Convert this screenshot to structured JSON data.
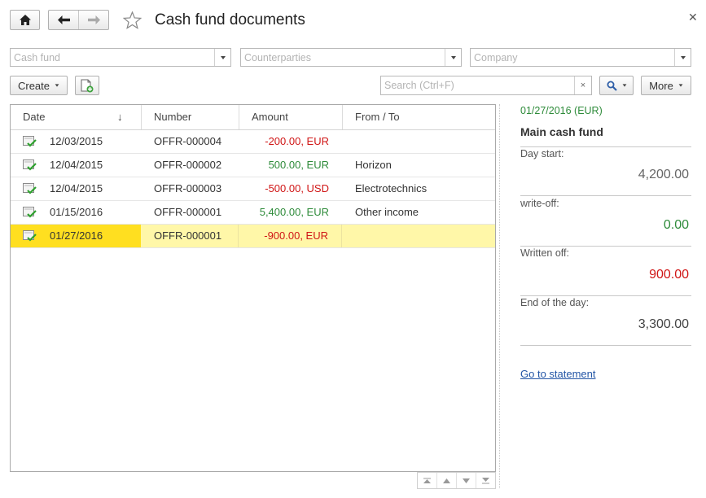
{
  "window": {
    "title": "Cash fund documents"
  },
  "filters": {
    "cash_fund_placeholder": "Cash fund",
    "counterparties_placeholder": "Counterparties",
    "company_placeholder": "Company"
  },
  "toolbar": {
    "create_label": "Create",
    "search_placeholder": "Search (Ctrl+F)",
    "search_clear": "×",
    "more_label": "More"
  },
  "table": {
    "columns": [
      "Date",
      "Number",
      "Amount",
      "From / To"
    ],
    "sort_indicator": "↓",
    "rows": [
      {
        "date": "12/03/2015",
        "number": "OFFR-000004",
        "amount": "-200.00, EUR",
        "sign": "negative",
        "from_to": ""
      },
      {
        "date": "12/04/2015",
        "number": "OFFR-000002",
        "amount": "500.00, EUR",
        "sign": "positive",
        "from_to": "Horizon"
      },
      {
        "date": "12/04/2015",
        "number": "OFFR-000003",
        "amount": "-500.00, USD",
        "sign": "negative",
        "from_to": "Electrotechnics"
      },
      {
        "date": "01/15/2016",
        "number": "OFFR-000001",
        "amount": "5,400.00, EUR",
        "sign": "positive",
        "from_to": "Other income"
      },
      {
        "date": "01/27/2016",
        "number": "OFFR-000001",
        "amount": "-900.00, EUR",
        "sign": "negative",
        "from_to": "",
        "selected": true
      }
    ]
  },
  "panel": {
    "date": "01/27/2016 (EUR)",
    "title": "Main cash fund",
    "day_start_label": "Day start:",
    "day_start_value": "4,200.00",
    "writeoff_label": "write-off:",
    "writeoff_value": "0.00",
    "written_off_label": "Written off:",
    "written_off_value": "900.00",
    "end_of_day_label": "End of the day:",
    "end_of_day_value": "3,300.00",
    "link": "Go to statement"
  },
  "colors": {
    "positive": "#2e8b3a",
    "negative": "#d01616",
    "selection": "#fff7a8",
    "selection_accent": "#ffdf20",
    "link": "#2456a6"
  },
  "icons": [
    "home-icon",
    "back-arrow-icon",
    "forward-arrow-icon",
    "star-icon",
    "close-icon",
    "add-from-copy-icon",
    "magnifier-icon",
    "document-posted-icon",
    "pager-first-icon",
    "pager-up-icon",
    "pager-down-icon",
    "pager-last-icon"
  ]
}
